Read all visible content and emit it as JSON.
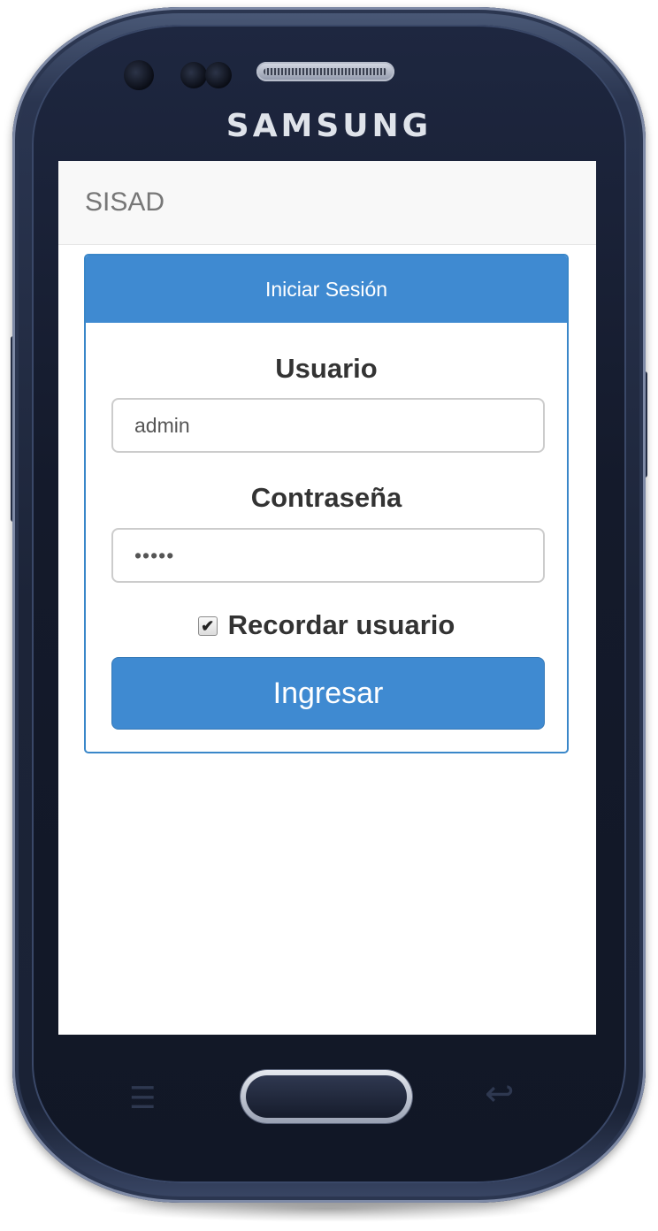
{
  "device": {
    "brand": "SAMSUNG"
  },
  "app": {
    "navbar_title": "SISAD"
  },
  "login_panel": {
    "heading": "Iniciar Sesión",
    "username_label": "Usuario",
    "username_value": "admin",
    "password_label": "Contraseña",
    "password_value": "•••••",
    "remember_label": "Recordar usuario",
    "remember_checked": true,
    "submit_label": "Ingresar"
  },
  "colors": {
    "accent": "#3f8ad1",
    "navbar_bg": "#f8f8f8",
    "phone_body": "#1c2438"
  },
  "icons": {
    "menu_key": "menu-icon",
    "back_key": "back-icon",
    "checkbox": "checkmark-icon"
  }
}
